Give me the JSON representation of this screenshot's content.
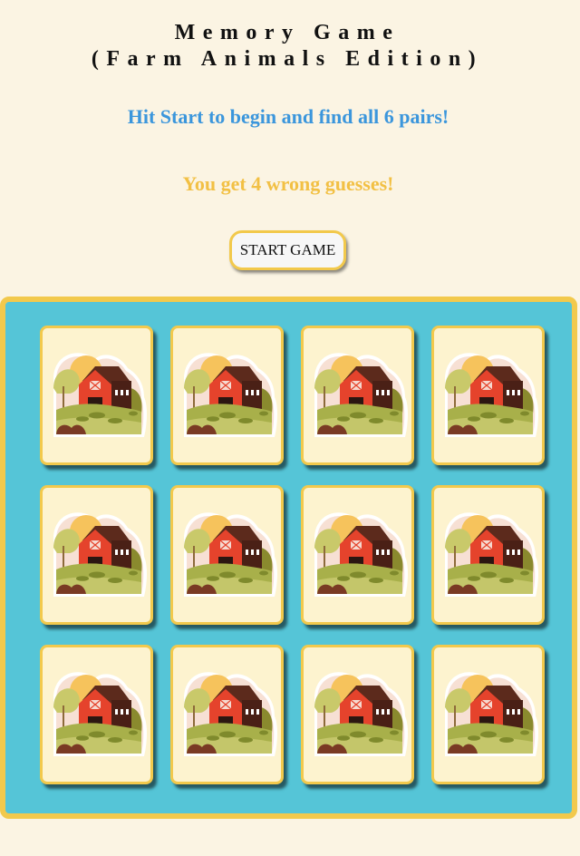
{
  "header": {
    "title_line1": "Memory Game",
    "title_line2": "(Farm Animals Edition)"
  },
  "instructions": "Hit Start to begin and find all 6 pairs!",
  "guess_info": "You get 4 wrong guesses!",
  "start_button": "START GAME",
  "board": {
    "rows": 3,
    "columns": 4,
    "card_back": "barn-farm-icon",
    "cards_face_down": 12
  },
  "colors": {
    "background": "#fbf4e3",
    "board": "#55c5d7",
    "border_accent": "#f2c94c",
    "instructions_text": "#3b96dc",
    "guess_text": "#f2c044",
    "card_face": "#fdf3cf"
  }
}
